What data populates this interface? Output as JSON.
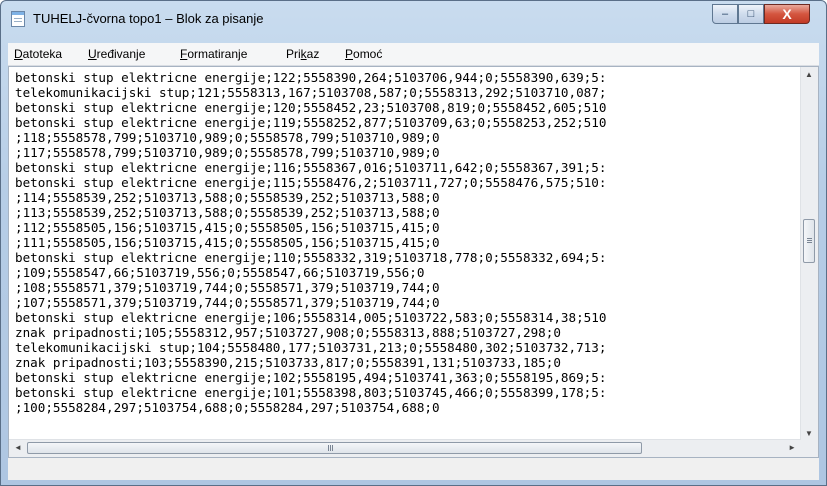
{
  "window": {
    "title": "TUHELJ-čvorna topo1 – Blok za pisanje",
    "controls": {
      "minimize": "–",
      "maximize": "□",
      "close": "X"
    }
  },
  "menu": [
    {
      "key": "D",
      "rest": "atoteka"
    },
    {
      "key": "U",
      "rest": "ređivanje"
    },
    {
      "key": "F",
      "rest": "ormatiranje"
    },
    {
      "pre": "Pri",
      "key": "k",
      "rest": "az"
    },
    {
      "key": "P",
      "rest": "omoć"
    }
  ],
  "editor": {
    "lines": [
      "betonski stup elektricne energije;122;5558390,264;5103706,944;0;5558390,639;5:",
      "telekomunikacijski stup;121;5558313,167;5103708,587;0;5558313,292;5103710,087;",
      "betonski stup elektricne energije;120;5558452,23;5103708,819;0;5558452,605;510",
      "betonski stup elektricne energije;119;5558252,877;5103709,63;0;5558253,252;510",
      ";118;5558578,799;5103710,989;0;5558578,799;5103710,989;0",
      ";117;5558578,799;5103710,989;0;5558578,799;5103710,989;0",
      "betonski stup elektricne energije;116;5558367,016;5103711,642;0;5558367,391;5:",
      "betonski stup elektricne energije;115;5558476,2;5103711,727;0;5558476,575;510:",
      ";114;5558539,252;5103713,588;0;5558539,252;5103713,588;0",
      ";113;5558539,252;5103713,588;0;5558539,252;5103713,588;0",
      ";112;5558505,156;5103715,415;0;5558505,156;5103715,415;0",
      ";111;5558505,156;5103715,415;0;5558505,156;5103715,415;0",
      "betonski stup elektricne energije;110;5558332,319;5103718,778;0;5558332,694;5:",
      ";109;5558547,66;5103719,556;0;5558547,66;5103719,556;0",
      ";108;5558571,379;5103719,744;0;5558571,379;5103719,744;0",
      ";107;5558571,379;5103719,744;0;5558571,379;5103719,744;0",
      "betonski stup elektricne energije;106;5558314,005;5103722,583;0;5558314,38;510",
      "znak pripadnosti;105;5558312,957;5103727,908;0;5558313,888;5103727,298;0",
      "telekomunikacijski stup;104;5558480,177;5103731,213;0;5558480,302;5103732,713;",
      "znak pripadnosti;103;5558390,215;5103733,817;0;5558391,131;5103733,185;0",
      "betonski stup elektricne energije;102;5558195,494;5103741,363;0;5558195,869;5:",
      "betonski stup elektricne energije;101;5558398,803;5103745,466;0;5558399,178;5:",
      ";100;5558284,297;5103754,688;0;5558284,297;5103754,688;0"
    ]
  },
  "scrollbars": {
    "vertical": {
      "up": "▲",
      "down": "▼"
    },
    "horizontal": {
      "left": "◄",
      "right": "►",
      "grip": "III"
    }
  }
}
